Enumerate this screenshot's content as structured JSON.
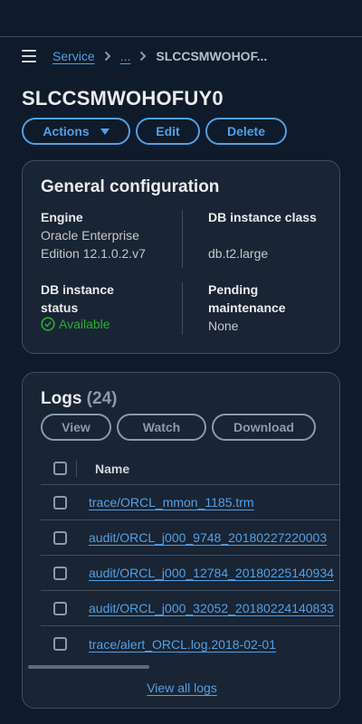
{
  "breadcrumb": {
    "items": [
      {
        "label": "Service"
      },
      {
        "label": "..."
      },
      {
        "label": "SLCCSMWOHOF..."
      }
    ]
  },
  "page": {
    "title": "SLCCSMWOHOFUY0",
    "buttons": {
      "actions": "Actions",
      "edit": "Edit",
      "delete": "Delete"
    }
  },
  "config": {
    "title": "General configuration",
    "engine": {
      "label": "Engine",
      "value": "Oracle Enterprise Edition 12.1.0.2.v7"
    },
    "instance_class": {
      "label": "DB instance class",
      "value": "db.t2.large"
    },
    "instance_status": {
      "label": "DB instance status",
      "value": "Available"
    },
    "pending": {
      "label": "Pending maintenance",
      "value": "None"
    }
  },
  "logs": {
    "title": "Logs",
    "count": "(24)",
    "buttons": {
      "view": "View",
      "watch": "Watch",
      "download": "Download"
    },
    "column_name": "Name",
    "rows": [
      {
        "name": "trace/ORCL_mmon_1185.trm"
      },
      {
        "name": "audit/ORCL_j000_9748_20180227220003"
      },
      {
        "name": "audit/ORCL_j000_12784_20180225140934"
      },
      {
        "name": "audit/ORCL_j000_32052_20180224140833"
      },
      {
        "name": "trace/alert_ORCL.log.2018-02-01"
      }
    ],
    "view_all": "View all logs"
  },
  "colors": {
    "background": "#0f1b2a",
    "panel": "#192534",
    "accent": "#539fe5",
    "success": "#29ad32"
  },
  "icons": [
    "menu-icon",
    "chevron-right-icon",
    "caret-down-icon",
    "status-check-icon"
  ]
}
